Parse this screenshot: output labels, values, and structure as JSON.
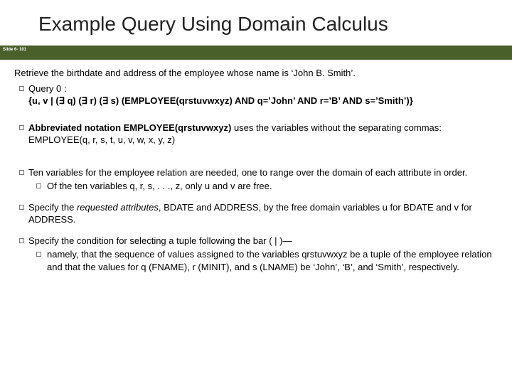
{
  "title": "Example Query Using Domain Calculus",
  "bar_label": "Slide 6-\n101",
  "intro": "Retrieve the birthdate and address of the employee whose name is ‘John B. Smith’.",
  "q0_label": "Query 0 :",
  "q0_body": "{u, v | (∃ q) (∃ r) (∃ s) (EMPLOYEE(qrstuvwxyz) AND q=’John’ AND r=’B’ AND s=’Smith’)}",
  "abbrev_prefix": "Abbreviated notation EMPLOYEE(qrstuvwxyz)",
  "abbrev_rest": " uses the variables without the separating commas: EMPLOYEE(q, r, s, t, u, v, w, x, y, z)",
  "ten_vars": "Ten variables for the employee relation are needed, one to range over the domain of each attribute in order.",
  "ten_sub": "Of the ten variables q, r, s, . . ., z, only u and v are free.",
  "specify1_a": "Specify the ",
  "specify1_b": "requested attributes",
  "specify1_c": ", BDATE and ADDRESS, by the free domain variables u for BDATE and v for ADDRESS.",
  "specify2": "Specify the condition for selecting a tuple following the bar ( | )—",
  "specify2_sub": "namely, that the sequence of values assigned to the variables qrstuvwxyz be a tuple of the employee relation and that the values for q (FNAME), r (MINIT), and s (LNAME) be ‘John’, ‘B’, and ‘Smith’, respectively."
}
